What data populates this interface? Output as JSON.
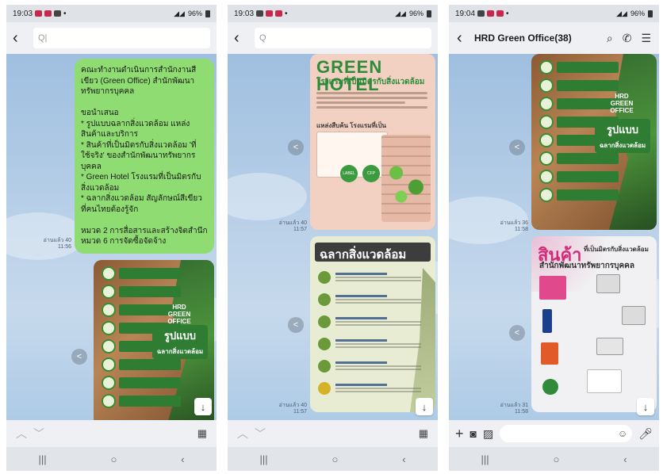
{
  "screens": [
    {
      "status": {
        "time": "19:03"
      },
      "search": {
        "placeholder": "Q|"
      },
      "message": {
        "lines": [
          "คณะทำงานดำเนินการสำนักงานสี",
          "เขียว (Green Office) สำนักพัฒนา",
          "ทรัพยากรบุคคล",
          "",
          "ขอนำเสนอ",
          "* รูปแบบฉลากสิ่งแวดล้อม แหล่ง",
          "สินค้าและบริการ",
          "* สินค้าที่เป็นมิตรกับสิ่งแวดล้อม 'ที่",
          "ใช้จริง' ของสำนักพัฒนาทรัพยากร",
          "บุคคล",
          "* Green Hotel โรงแรมที่เป็นมิตรกับ",
          "สิ่งแวดล้อม",
          "* ฉลากสิ่งแวดล้อม สัญลักษณ์สีเขียว",
          "ที่คนไทยต้องรู้จัก",
          "",
          "หมวด 2 การสื่อสารและสร้างจิตสำนึก",
          "หมวด 6  การจัดซื้อจัดจ้าง"
        ],
        "read": "อ่านแล้ว 40",
        "time": "11:56"
      },
      "image": {
        "title": "รูปแบบ",
        "subtitle": "ฉลากสิ่งแวดล้อม",
        "badge": "HRD GREEN OFFICE"
      }
    },
    {
      "status": {
        "time": "19:03"
      },
      "search": {
        "placeholder": "Q"
      },
      "poster": {
        "title": "GREEN HOTEL",
        "subtitle": "โรงแรมที่เป็นมิตรกับสิ่งแวดล้อม",
        "section": "แหล่งสืบค้น โรงแรมที่เป็นมิตรกับสิ่งแวดล้อม"
      },
      "meta1": {
        "read": "อ่านแล้ว 40",
        "time": "11:57"
      },
      "label_card": {
        "title": "ฉลากสิ่งแวดล้อม"
      },
      "meta2": {
        "read": "อ่านแล้ว 40",
        "time": "11:57"
      }
    },
    {
      "status": {
        "time": "19:04"
      },
      "header": {
        "title": "HRD Green Office(38)"
      },
      "image": {
        "title": "รูปแบบ",
        "subtitle": "ฉลากสิ่งแวดล้อม"
      },
      "meta1": {
        "read": "อ่านแล้ว 36",
        "time": "11:58"
      },
      "products": {
        "title": "สินค้า",
        "subtitle": "ที่เป็นมิตรกับสิ่งแวดล้อม",
        "office": "สำนักพัฒนาทรัพยากรบุคคล"
      },
      "meta2": {
        "read": "อ่านแล้ว 31",
        "time": "11:58"
      }
    }
  ],
  "status_common": {
    "battery": "96%"
  },
  "icons": [
    "back-icon",
    "search-icon",
    "share-icon",
    "arrow-down-icon",
    "calendar-icon",
    "chevron-up-icon",
    "chevron-down-icon",
    "phone-icon",
    "menu-icon",
    "plus-icon",
    "camera-icon",
    "gallery-icon",
    "emoji-icon",
    "mic-icon",
    "recents-icon",
    "home-icon",
    "nav-back-icon"
  ],
  "colors": {
    "bubble": "#8fdc72",
    "chat_bg": "#b9d0e8",
    "accent_green": "#2f8a3a"
  }
}
